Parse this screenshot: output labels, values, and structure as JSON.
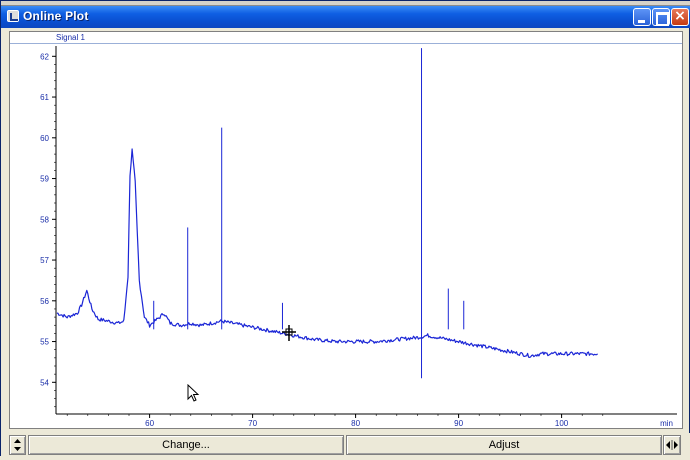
{
  "window": {
    "title": "Online Plot"
  },
  "legend": {
    "signal_name": "Signal 1"
  },
  "toolbar": {
    "change_label": "Change...",
    "adjust_label": "Adjust"
  },
  "icons": {
    "app": "plot-app-icon",
    "minimize": "minimize-icon",
    "maximize": "maximize-icon",
    "close": "close-icon",
    "scroll_vertical": "scroll-up-down-icon",
    "scroll_horizontal": "scroll-left-right-icon"
  },
  "colors": {
    "trace": "#1b26d6",
    "axis_text": "#1a2ea8",
    "title_bar": "#0a4fd0"
  },
  "chart_data": {
    "type": "line",
    "title": "",
    "xlabel": "min",
    "ylabel": "",
    "xlim": [
      51,
      105
    ],
    "ylim": [
      53.2,
      62.2
    ],
    "x_ticks": [
      60,
      70,
      80,
      90,
      100
    ],
    "y_ticks": [
      54,
      55,
      56,
      57,
      58,
      59,
      60,
      61,
      62
    ],
    "grid": false,
    "series": [
      {
        "name": "Signal 1",
        "x": [
          51.0,
          52.0,
          53.0,
          53.4,
          53.9,
          54.4,
          55.0,
          56.0,
          57.0,
          57.5,
          57.9,
          58.1,
          58.3,
          58.6,
          59.0,
          59.5,
          60.0,
          60.5,
          61.0,
          61.4,
          62.0,
          63.0,
          64.0,
          65.0,
          66.0,
          67.0,
          68.0,
          69.0,
          70.0,
          71.0,
          72.0,
          73.0,
          74.0,
          75.0,
          76.0,
          78.0,
          80.0,
          82.0,
          84.0,
          86.0,
          87.0,
          88.0,
          89.0,
          90.0,
          92.0,
          94.0,
          96.0,
          97.0,
          98.0,
          100.0,
          102.0,
          103.5
        ],
        "y": [
          55.7,
          55.6,
          55.7,
          55.9,
          56.25,
          55.8,
          55.55,
          55.5,
          55.45,
          55.5,
          56.6,
          59.1,
          59.7,
          58.9,
          56.5,
          55.6,
          55.4,
          55.5,
          55.6,
          55.7,
          55.45,
          55.4,
          55.45,
          55.4,
          55.45,
          55.5,
          55.45,
          55.4,
          55.35,
          55.3,
          55.25,
          55.2,
          55.15,
          55.1,
          55.05,
          55.0,
          55.0,
          55.0,
          55.05,
          55.1,
          55.15,
          55.1,
          55.05,
          55.0,
          54.9,
          54.8,
          54.7,
          54.65,
          54.7,
          54.7,
          54.7,
          54.7
        ]
      }
    ],
    "spikes": [
      {
        "x": 60.4,
        "y": 56.0
      },
      {
        "x": 63.7,
        "y": 57.8
      },
      {
        "x": 67.0,
        "y": 60.25
      },
      {
        "x": 72.9,
        "y": 55.95
      },
      {
        "x": 86.4,
        "y": 62.2,
        "y_low": 54.1
      },
      {
        "x": 89.0,
        "y": 56.3
      },
      {
        "x": 90.5,
        "y": 56.0
      }
    ]
  }
}
